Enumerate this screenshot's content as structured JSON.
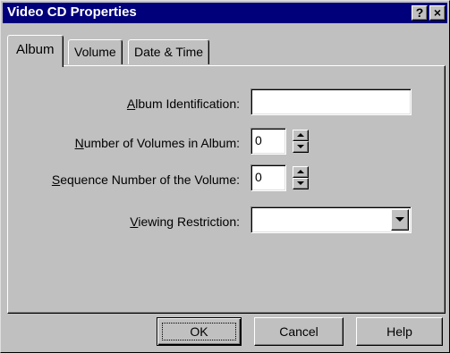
{
  "window": {
    "title": "Video CD Properties",
    "help_glyph": "?",
    "close_glyph": "×"
  },
  "tabs": [
    {
      "label": "Album",
      "active": true
    },
    {
      "label": "Volume",
      "active": false
    },
    {
      "label": "Date & Time",
      "active": false
    }
  ],
  "album": {
    "album_identification": {
      "label_pre": "",
      "label_key": "A",
      "label_post": "lbum Identification:",
      "value": ""
    },
    "number_of_volumes": {
      "label_pre": "",
      "label_key": "N",
      "label_post": "umber of Volumes in Album:",
      "value": "0"
    },
    "sequence_number": {
      "label_pre": "",
      "label_key": "S",
      "label_post": "equence Number of the Volume:",
      "value": "0"
    },
    "viewing_restriction": {
      "label_pre": "",
      "label_key": "V",
      "label_post": "iewing Restriction:",
      "value": ""
    }
  },
  "buttons": {
    "ok": "OK",
    "cancel": "Cancel",
    "help": "Help"
  },
  "icons": {
    "spin_up": "spin-up-arrow-icon",
    "spin_down": "spin-down-arrow-icon",
    "dropdown": "chevron-down-icon"
  }
}
